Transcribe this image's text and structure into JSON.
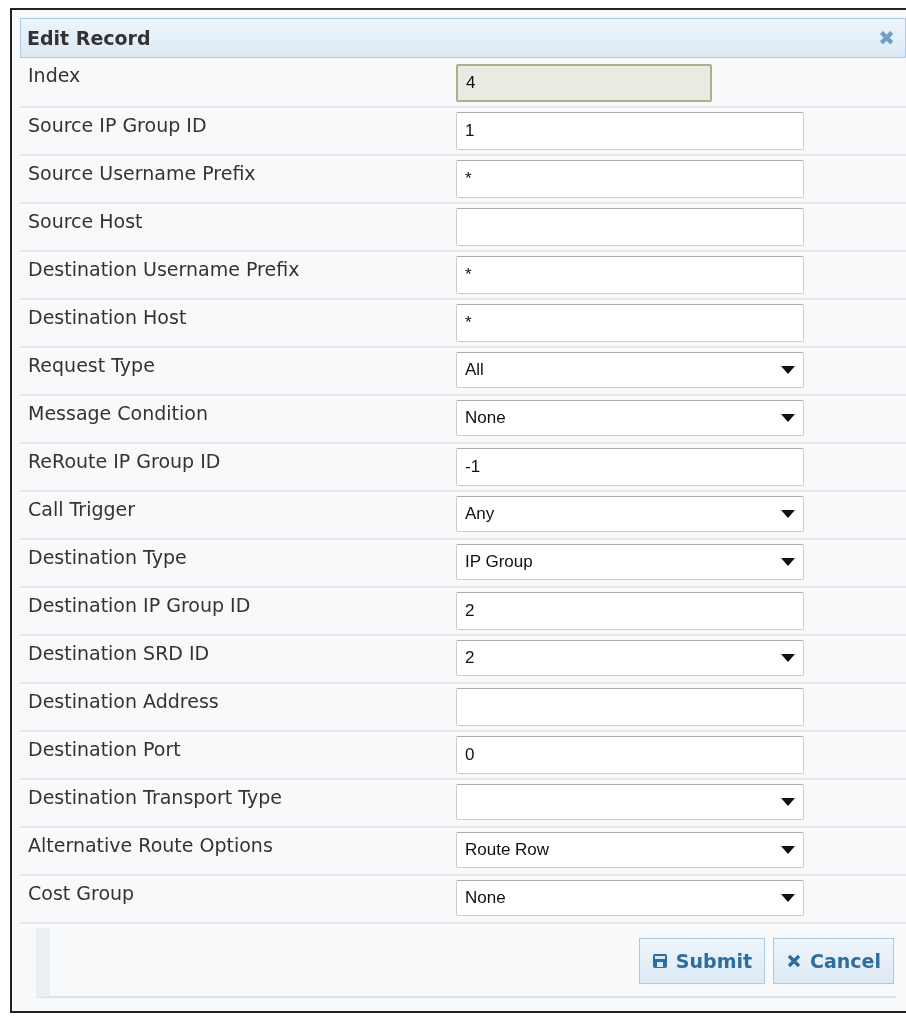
{
  "dialog": {
    "title": "Edit Record",
    "close": "✖"
  },
  "fields": [
    {
      "label": "Index",
      "kind": "readonly",
      "value": "4"
    },
    {
      "label": "Source IP Group ID",
      "kind": "text",
      "value": "1"
    },
    {
      "label": "Source Username Prefix",
      "kind": "text",
      "value": "*"
    },
    {
      "label": "Source Host",
      "kind": "text"
    },
    {
      "label": "Destination Username Prefix",
      "kind": "text",
      "value": "*"
    },
    {
      "label": "Destination Host",
      "kind": "text",
      "value": "*"
    },
    {
      "label": "Request Type",
      "kind": "select",
      "value": "All"
    },
    {
      "label": "Message Condition",
      "kind": "select",
      "value": "None"
    },
    {
      "label": "ReRoute IP Group ID",
      "kind": "text",
      "value": "-1"
    },
    {
      "label": "Call Trigger",
      "kind": "select",
      "value": "Any"
    },
    {
      "label": "Destination Type",
      "kind": "select",
      "value": "IP Group"
    },
    {
      "label": "Destination IP Group ID",
      "kind": "text",
      "value": "2"
    },
    {
      "label": "Destination SRD ID",
      "kind": "select",
      "value": "2"
    },
    {
      "label": "Destination Address",
      "kind": "text"
    },
    {
      "label": "Destination Port",
      "kind": "text",
      "value": "0"
    },
    {
      "label": "Destination Transport Type",
      "kind": "select"
    },
    {
      "label": "Alternative Route Options",
      "kind": "select",
      "value": "Route Row"
    },
    {
      "label": "Cost Group",
      "kind": "select",
      "value": "None"
    }
  ],
  "buttons": [
    {
      "kind": "submit",
      "label": "Submit"
    },
    {
      "kind": "cancel",
      "label": "Cancel"
    }
  ]
}
